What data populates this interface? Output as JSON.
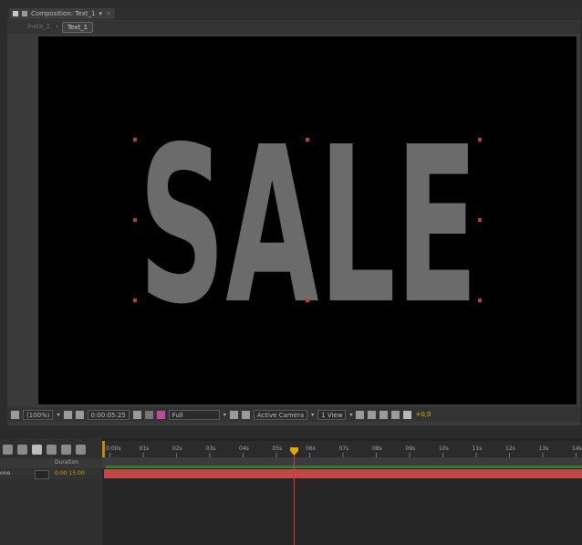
{
  "composition_panel": {
    "tab_title": "Composition: Text_1",
    "tab_menu_arrow": "▾",
    "tab_close": "×",
    "breadcrumb_parent": "Insta_1",
    "breadcrumb_separator": "‹",
    "breadcrumb_current": "Text_1"
  },
  "viewer": {
    "text_layer": "SALE",
    "background": "#000000",
    "text_color": "#6b6b6b",
    "handle_color": "#c23a3a"
  },
  "viewer_toolbar": {
    "magnification": "(100%)",
    "timecode": "0:00:05:25",
    "resolution": "Full",
    "camera": "Active Camera",
    "view_layout": "1 View",
    "exposure": "+0,0"
  },
  "timeline": {
    "duration_header": "Duration",
    "blend_mode": "one",
    "duration_value": "0:00:15:00",
    "ruler_labels": [
      "0:00s",
      "01s",
      "02s",
      "03s",
      "04s",
      "05s",
      "06s",
      "07s",
      "08s",
      "09s",
      "10s",
      "11s",
      "12s",
      "13s",
      "14s"
    ],
    "playhead_seconds": 5.9,
    "colors": {
      "layer_bar": "#c24848",
      "work_area": "#2f7d2f",
      "playhead": "#d23a3a",
      "accent": "#c9a000"
    }
  }
}
